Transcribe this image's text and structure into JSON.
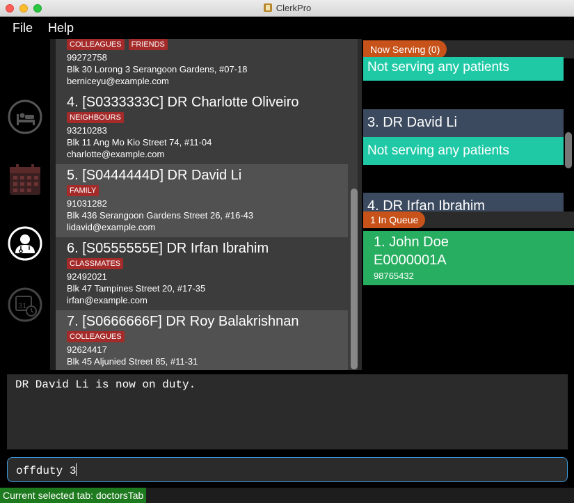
{
  "window": {
    "title": "ClerkPro"
  },
  "menu": {
    "file": "File",
    "help": "Help"
  },
  "sidebar": {
    "items": [
      {
        "icon": "bed-icon"
      },
      {
        "icon": "calendar-icon"
      },
      {
        "icon": "doctor-icon",
        "selected": true
      },
      {
        "icon": "calendar-clock-icon"
      }
    ]
  },
  "doctors": [
    {
      "name": "",
      "tags": [
        "COLLEAGUES",
        "FRIENDS"
      ],
      "phone": "99272758",
      "address": "Blk 30 Lorong 3 Serangoon Gardens, #07-18",
      "email": "berniceyu@example.com"
    },
    {
      "name": "4.  [S0333333C]  DR Charlotte Oliveiro",
      "tags": [
        "NEIGHBOURS"
      ],
      "phone": "93210283",
      "address": "Blk 11 Ang Mo Kio Street 74, #11-04",
      "email": "charlotte@example.com"
    },
    {
      "name": "5.  [S0444444D]  DR David Li",
      "tags": [
        "FAMILY"
      ],
      "phone": "91031282",
      "address": "Blk 436 Serangoon Gardens Street 26, #16-43",
      "email": "lidavid@example.com"
    },
    {
      "name": "6.  [S0555555E]  DR Irfan Ibrahim",
      "tags": [
        "CLASSMATES"
      ],
      "phone": "92492021",
      "address": "Blk 47 Tampines Street 20, #17-35",
      "email": "irfan@example.com"
    },
    {
      "name": "7.  [S0666666F]  DR Roy Balakrishnan",
      "tags": [
        "COLLEAGUES"
      ],
      "phone": "92624417",
      "address": "Blk 45 Aljunied Street 85, #11-31",
      "email": ""
    }
  ],
  "now_serving": {
    "header": "Now Serving (0)",
    "top_status": "Not serving any patients",
    "rooms": [
      {
        "doctor": "3. DR David Li",
        "status": "Not serving any patients"
      },
      {
        "doctor": "4. DR Irfan Ibrahim"
      }
    ]
  },
  "queue": {
    "header": "1 In Queue",
    "patients": [
      {
        "name": "1.  John Doe",
        "id": "E0000001A",
        "phone": "98765432"
      }
    ]
  },
  "result": "DR David Li is now on duty.",
  "command": {
    "value": "offduty 3"
  },
  "status": "Current selected tab: doctorsTab",
  "colors": {
    "tag": "#a52a2a",
    "section_header": "#c8531a",
    "serving": "#20c9a6",
    "doctor_header": "#3b4a5e",
    "queue_card": "#27ae60",
    "status_bar": "#1e7a1e",
    "command_border": "#3d9be0"
  }
}
